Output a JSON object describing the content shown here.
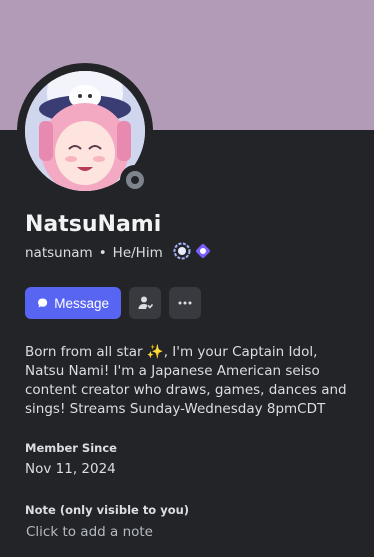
{
  "profile": {
    "display_name": "NatsuNami",
    "username": "natsunam",
    "separator": "•",
    "pronouns": "He/Him",
    "badges": [
      "hypesquad-badge",
      "quest-badge"
    ],
    "status": "offline"
  },
  "actions": {
    "message_label": "Message",
    "add_friend_icon": "add-friend-icon",
    "more_icon": "more-icon"
  },
  "bio": {
    "part1": "Born from all star ",
    "emoji": "✨",
    "part2": ", I'm your Captain Idol, Natsu Nami! I'm a Japanese American seiso content creator who draws, games, dances and sings! Streams Sunday-Wednesday 8pmCDT"
  },
  "member_since": {
    "label": "Member Since",
    "value": "Nov 11, 2024"
  },
  "note": {
    "label": "Note (only visible to you)",
    "placeholder": "Click to add a note"
  },
  "colors": {
    "banner": "#b29bb6",
    "background": "#232428",
    "accent": "#5865f2"
  }
}
